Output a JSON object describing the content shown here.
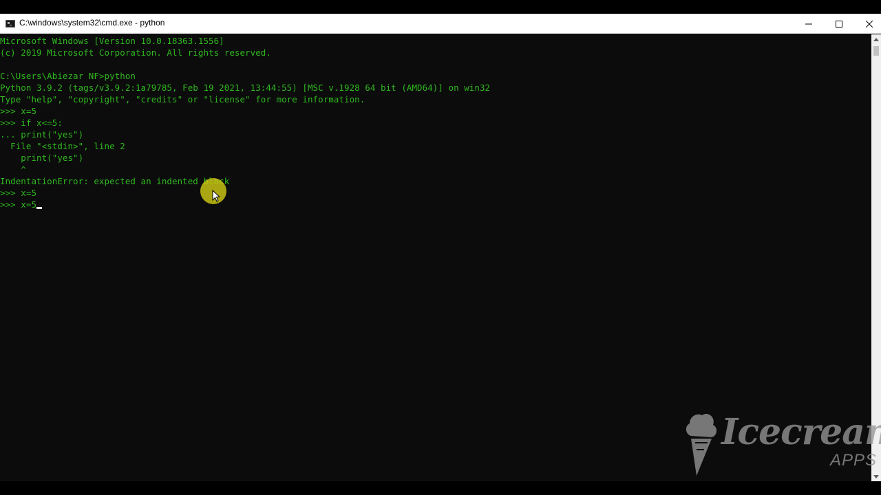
{
  "window": {
    "title": "C:\\windows\\system32\\cmd.exe - python",
    "minimize_icon": "minimize-icon",
    "maximize_icon": "maximize-icon",
    "close_icon": "close-icon"
  },
  "console": {
    "lines": [
      "Microsoft Windows [Version 10.0.18363.1556]",
      "(c) 2019 Microsoft Corporation. All rights reserved.",
      "",
      "C:\\Users\\Abiezar NF>python",
      "Python 3.9.2 (tags/v3.9.2:1a79785, Feb 19 2021, 13:44:55) [MSC v.1928 64 bit (AMD64)] on win32",
      "Type \"help\", \"copyright\", \"credits\" or \"license\" for more information.",
      ">>> x=5",
      ">>> if x<=5:",
      "... print(\"yes\")",
      "  File \"<stdin>\", line 2",
      "    print(\"yes\")",
      "    ^",
      "IndentationError: expected an indented block",
      ">>> x=5",
      ">>> x=5"
    ],
    "text_color": "#2fb81f",
    "background": "#0c0c0c"
  },
  "watermark": {
    "brand": "Icecream",
    "sub": "APPS"
  },
  "colors": {
    "titlebar": "#ffffff",
    "click_highlight": "#cdc814"
  }
}
